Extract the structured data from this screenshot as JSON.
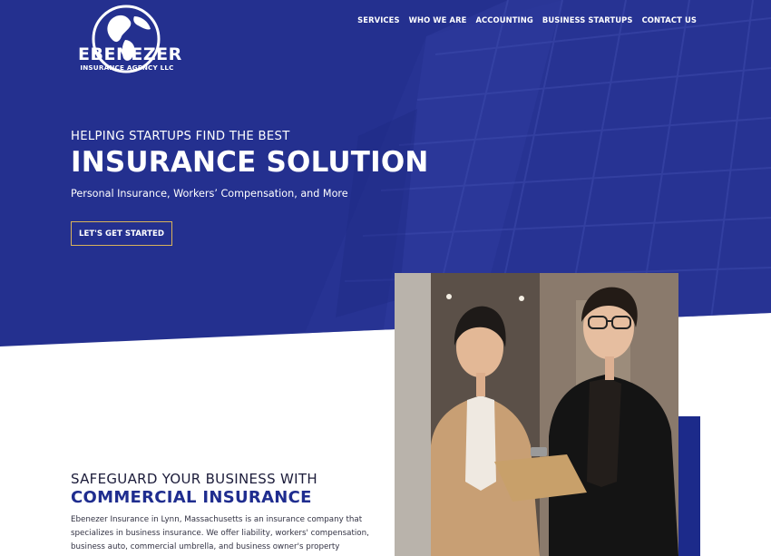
{
  "brand": {
    "name": "EBENEZER",
    "tagline": "INSURANCE AGENCY LLC",
    "logo_icon": "globe-icon"
  },
  "nav": {
    "items": [
      "SERVICES",
      "WHO WE ARE",
      "ACCOUNTING",
      "BUSINESS STARTUPS",
      "CONTACT US"
    ]
  },
  "hero": {
    "kicker": "HELPING STARTUPS FIND THE BEST",
    "title": "INSURANCE SOLUTION",
    "subtitle": "Personal Insurance, Workers’ Compensation, and More",
    "cta_label": "LET'S GET STARTED"
  },
  "section": {
    "kicker": "SAFEGUARD YOUR BUSINESS WITH",
    "title": "COMMERCIAL INSURANCE",
    "body": "Ebenezer Insurance in Lynn, Massachusetts is an insurance company that specializes in business insurance. We offer liability, workers' compensation, business auto, commercial umbrella, and business owner's property"
  },
  "colors": {
    "hero_blue": "#24308f",
    "accent_navy": "#1c2a8a",
    "title_blue": "#1f2d8f",
    "cta_border": "#d9b35a"
  }
}
